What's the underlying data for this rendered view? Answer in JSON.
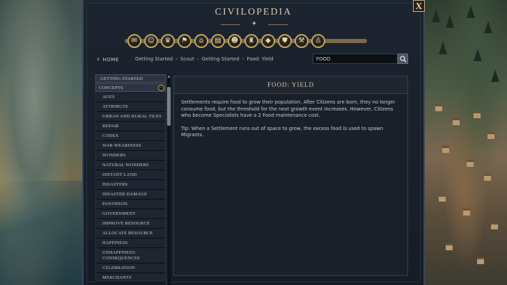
{
  "window": {
    "title": "CIVILOPEDIA",
    "close_label": "X"
  },
  "categories": [
    {
      "icon": "scroll-icon"
    },
    {
      "icon": "mask-icon"
    },
    {
      "icon": "trophy-icon"
    },
    {
      "icon": "flag-icon"
    },
    {
      "icon": "city-icon"
    },
    {
      "icon": "building-icon"
    },
    {
      "icon": "people-icon"
    },
    {
      "icon": "tower-icon"
    },
    {
      "icon": "resource-icon"
    },
    {
      "icon": "shield-icon"
    },
    {
      "icon": "pickaxe-icon"
    },
    {
      "icon": "person-icon"
    }
  ],
  "nav": {
    "home_label": "HOME",
    "breadcrumbs": [
      "Getting Started",
      "Scout",
      "Getting Started",
      "Food: Yield"
    ],
    "search_value": "FOOD"
  },
  "sidebar": {
    "header_getting_started": "GETTING STARTED",
    "header_concepts": "CONCEPTS",
    "items": [
      "AGES",
      "ATTRIBUTE",
      "URBAN AND RURAL TILES",
      "REPAIR",
      "CODEX",
      "WAR WEARINESS",
      "WONDERS",
      "NATURAL WONDERS",
      "DISTANT LAND",
      "DISASTERS",
      "DISASTER DAMAGE",
      "PANTHEON",
      "GOVERNMENT",
      "IMPROVE RESOURCE",
      "ALLOCATE RESOURCE",
      "HAPPINESS",
      "UNHAPPINESS: CONSEQUENCES",
      "CELEBRATION",
      "MERCHANTS"
    ]
  },
  "article": {
    "title": "FOOD: YIELD",
    "paragraphs": [
      "Settlements require food to grow their population. After Citizens are born, they no longer consume food, but the threshold for the next growth event increases. However, Citizens who become Specialists have a 2 Food maintenance cost.",
      "Tip: When a Settlement runs out of space to grow, the excess food is used to spawn Migrants."
    ]
  }
}
